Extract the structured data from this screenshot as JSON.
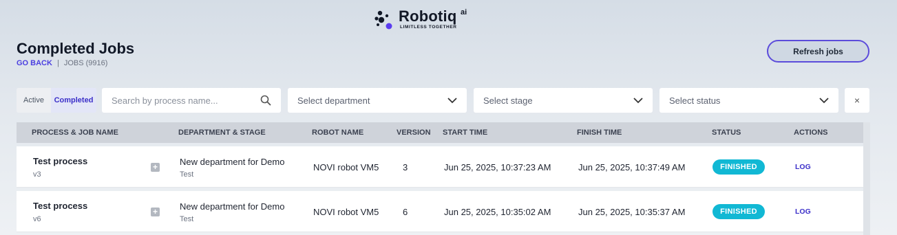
{
  "brand": {
    "name": "Robotiq",
    "superscript": "ai",
    "tagline": "LIMITLESS TOGETHER"
  },
  "header": {
    "title": "Completed Jobs",
    "back_label": "GO BACK",
    "separator": "|",
    "jobs_count": "JOBS (9916)",
    "refresh_label": "Refresh jobs"
  },
  "filters": {
    "toggle_active": "Active",
    "toggle_completed": "Completed",
    "search_placeholder": "Search by process name...",
    "department_placeholder": "Select department",
    "stage_placeholder": "Select stage",
    "status_placeholder": "Select status",
    "clear_icon": "×"
  },
  "table": {
    "columns": [
      "PROCESS & JOB NAME",
      "DEPARTMENT & STAGE",
      "ROBOT NAME",
      "VERSION",
      "START TIME",
      "FINISH TIME",
      "STATUS",
      "ACTIONS"
    ],
    "rows": [
      {
        "process": "Test process",
        "version_tag": "v3",
        "department": "New department for Demo",
        "stage": "Test",
        "robot": "NOVI robot VM5",
        "version": "3",
        "start": "Jun 25, 2025, 10:37:23 AM",
        "finish": "Jun 25, 2025, 10:37:49 AM",
        "status": "FINISHED",
        "action": "LOG"
      },
      {
        "process": "Test process",
        "version_tag": "v6",
        "department": "New department for Demo",
        "stage": "Test",
        "robot": "NOVI robot VM5",
        "version": "6",
        "start": "Jun 25, 2025, 10:35:02 AM",
        "finish": "Jun 25, 2025, 10:35:37 AM",
        "status": "FINISHED",
        "action": "LOG"
      }
    ]
  },
  "colors": {
    "accent": "#4b3fe0",
    "status_finished": "#11b8d4"
  }
}
